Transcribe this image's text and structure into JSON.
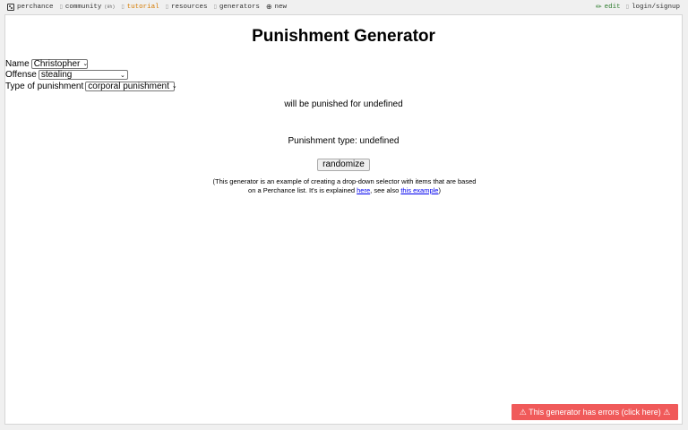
{
  "nav": {
    "brand": "perchance",
    "community": "community",
    "community_count": "(9h)",
    "tutorial": "tutorial",
    "resources": "resources",
    "generators": "generators",
    "new": "new",
    "edit": "edit",
    "login": "login/signup"
  },
  "page": {
    "title": "Punishment Generator",
    "form": {
      "name_label": "Name",
      "name_value": "Christopher",
      "offense_label": "Offense",
      "offense_value": "stealing",
      "type_label": "Type of punishment",
      "type_value": "corporal punishment"
    },
    "sentence": "will be punished for undefined",
    "punishment_type_line": "Punishment type: undefined",
    "randomize_label": "randomize",
    "note": {
      "text_1": "(This generator is an example of creating a drop-down selector with items that are based on a Perchance list. It's is explained ",
      "link_here": "here",
      "text_2": ", see also ",
      "link_example": "this example",
      "text_3": ")"
    }
  },
  "error_banner": "⚠ This generator has errors (click here) ⚠",
  "colors": {
    "tutorial": "#d47a00",
    "edit": "#2a7a2a",
    "error_bg": "#f05a5a",
    "link": "#0000ee"
  }
}
